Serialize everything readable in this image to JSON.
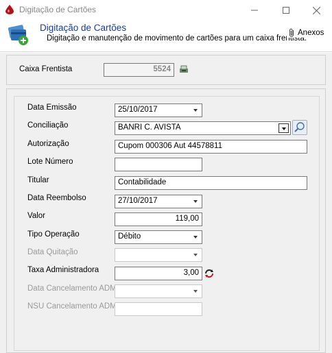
{
  "window": {
    "title": "Digitação de Cartões"
  },
  "header": {
    "title": "Digitação de Cartões",
    "subtitle": "Digitação e manutenção de movimento de cartões para um caixa frentista.",
    "anexos_label": "Anexos"
  },
  "caixa": {
    "label": "Caixa Frentista",
    "value": "5524"
  },
  "form": {
    "data_emissao": {
      "label": "Data Emissão",
      "value": "25/10/2017"
    },
    "conciliacao": {
      "label": "Conciliação",
      "value": "BANRI C. AVISTA"
    },
    "autorizacao": {
      "label": "Autorização",
      "value": "Cupom 000306 Aut 44578811"
    },
    "lote_numero": {
      "label": "Lote Número",
      "value": ""
    },
    "titular": {
      "label": "Titular",
      "value": "Contabilidade"
    },
    "data_reembolso": {
      "label": "Data Reembolso",
      "value": "27/10/2017"
    },
    "valor": {
      "label": "Valor",
      "value": "119,00"
    },
    "tipo_operacao": {
      "label": "Tipo Operação",
      "value": "Débito"
    },
    "data_quitacao": {
      "label": "Data Quitação",
      "value": ""
    },
    "taxa_administradora": {
      "label": "Taxa Administradora",
      "value": "3,00"
    },
    "data_cancelamento_adm": {
      "label": "Data Cancelamento ADM",
      "value": ""
    },
    "nsu_cancelamento_adm": {
      "label": "NSU Cancelamento ADM",
      "value": ""
    }
  },
  "colors": {
    "header_title": "#1a3d8f",
    "disabled_text": "#9a9a9a",
    "panel_bg": "#f0f0f0"
  },
  "icons": {
    "app": "blood-drop-icon",
    "header": "cards-add-icon",
    "anexos": "paperclip-icon",
    "caixa_lookup": "cashier-icon",
    "conciliacao_search": "magnifier-icon",
    "taxa_refresh": "refresh-icon"
  }
}
